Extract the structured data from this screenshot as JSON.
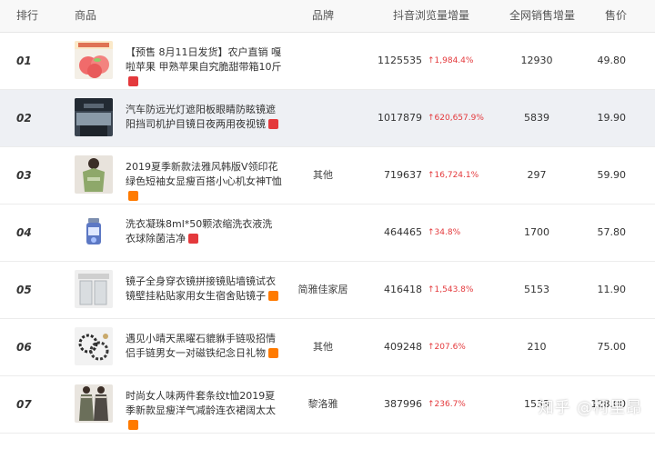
{
  "header": {
    "rank": "排行",
    "product": "商品",
    "brand": "品牌",
    "views": "抖音浏览量增量",
    "sales": "全网销售增量",
    "price": "售价"
  },
  "rows": [
    {
      "rank": "01",
      "title": "【预售 8月11日发货】农户直销 嘎啦苹果 甲熟苹果自究脆甜带箱10斤",
      "badge": "tmall",
      "brand": "",
      "views": "1125535",
      "growth": "↑1,984.4%",
      "sales": "12930",
      "price": "49.80",
      "thumb": "apple-product-thumb"
    },
    {
      "rank": "02",
      "title": "汽车防远光灯遮阳板眼睛防眩镜遮阳挡司机护目镜日夜两用夜视镜",
      "badge": "tmall",
      "brand": "",
      "views": "1017879",
      "growth": "↑620,657.9%",
      "sales": "5839",
      "price": "19.90",
      "thumb": "car-visor-thumb"
    },
    {
      "rank": "03",
      "title": "2019夏季新款法雅风韩版V领印花绿色短袖女显瘦百搭小心机女神T恤",
      "badge": "taobao",
      "brand": "其他",
      "views": "719637",
      "growth": "↑16,724.1%",
      "sales": "297",
      "price": "59.90",
      "thumb": "tshirt-thumb"
    },
    {
      "rank": "04",
      "title": "洗衣凝珠8ml*50颗浓缩洗衣液洗衣球除菌洁净",
      "badge": "tmall",
      "brand": "",
      "views": "464465",
      "growth": "↑34.8%",
      "sales": "1700",
      "price": "57.80",
      "thumb": "laundry-pod-thumb"
    },
    {
      "rank": "05",
      "title": "镜子全身穿衣镜拼接镜贴墙镜试衣镜壁挂粘贴家用女生宿舍贴镜子",
      "badge": "taobao",
      "brand": "简雅佳家居",
      "views": "416418",
      "growth": "↑1,543.8%",
      "sales": "5153",
      "price": "11.90",
      "thumb": "mirror-thumb"
    },
    {
      "rank": "06",
      "title": "遇见小晴天黑曜石貔貅手链吸招情侣手链男女一对磁铁纪念日礼物",
      "badge": "taobao",
      "brand": "其他",
      "views": "409248",
      "growth": "↑207.6%",
      "sales": "210",
      "price": "75.00",
      "thumb": "bracelet-thumb"
    },
    {
      "rank": "07",
      "title": "时尚女人味两件套条纹t恤2019夏季新款显瘦洋气减龄连衣裙阔太太",
      "badge": "taobao",
      "brand": "黎洛雅",
      "views": "387996",
      "growth": "↑236.7%",
      "sales": "1533",
      "price": "128.00",
      "thumb": "dress-thumb"
    }
  ],
  "watermark": "知乎 @柯里昂",
  "colors": {
    "accent_red": "#e4393c",
    "tmall_badge": "#e4393c",
    "taobao_badge": "#ff7a00",
    "alt_row": "#eef0f4"
  }
}
